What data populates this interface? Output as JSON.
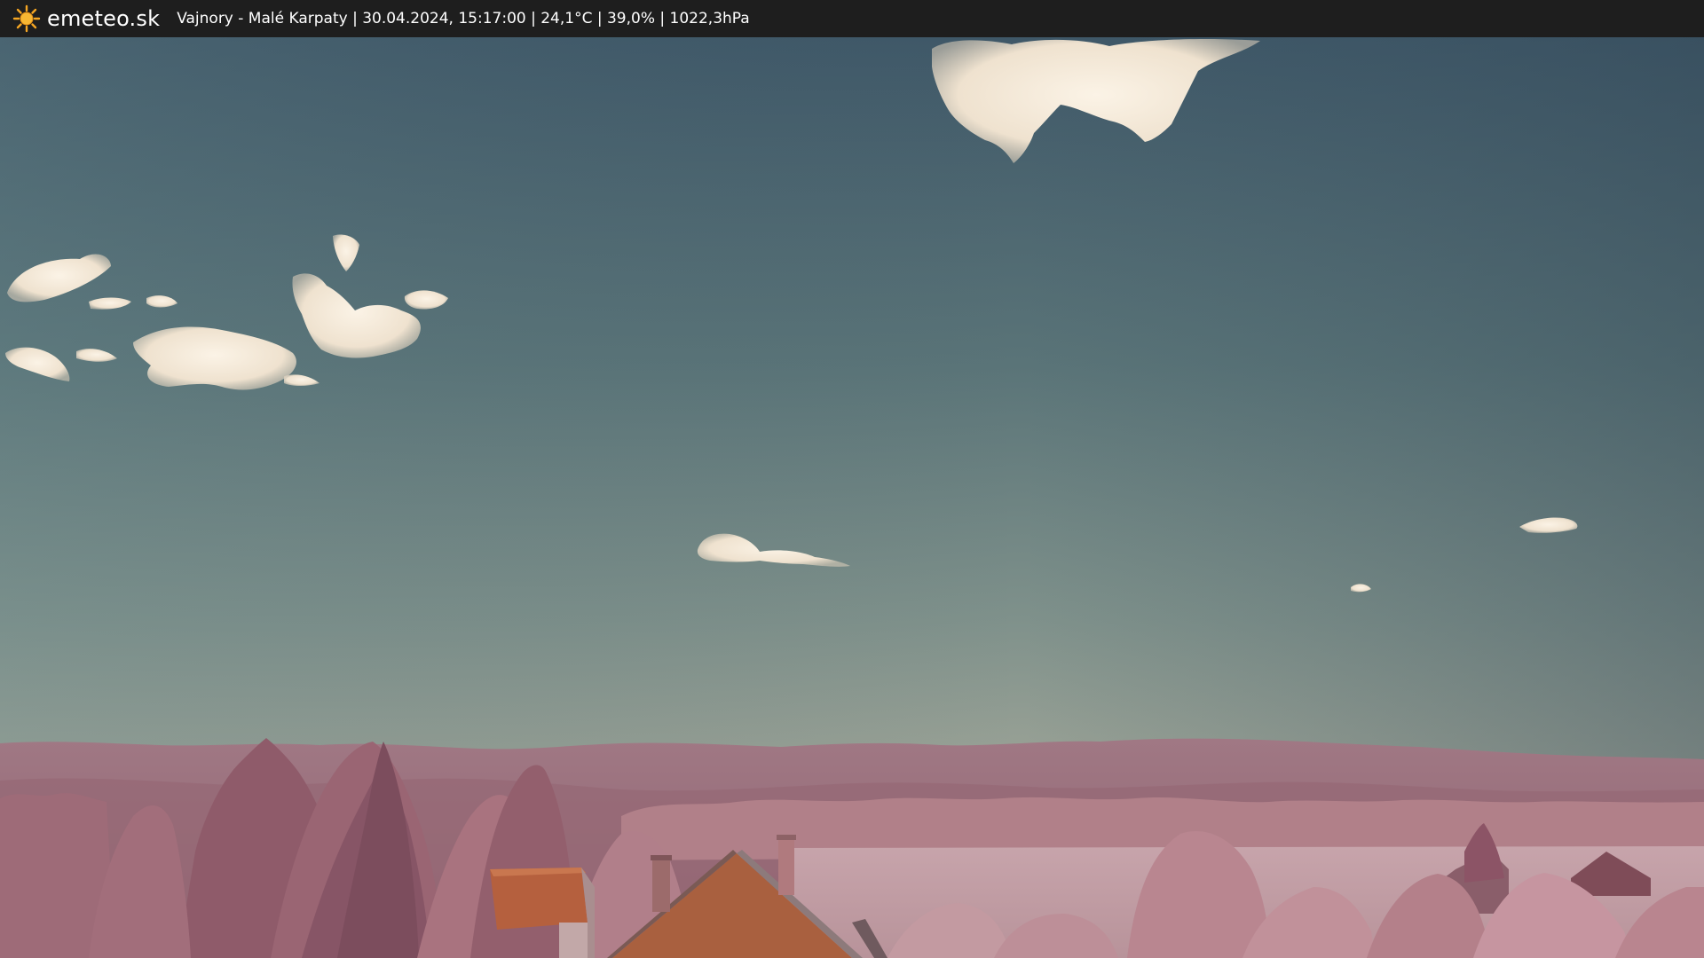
{
  "header": {
    "logo_icon": "sun-icon",
    "brand": "emeteo.sk",
    "caption": "Vajnory - Malé Karpaty | 30.04.2024, 15:17:00 | 24,1°C | 39,0% | 1022,3hPa"
  },
  "colors": {
    "bar": "#1e1e1e",
    "sun": "#f5a623",
    "sky_top": "#3f5a6b",
    "sky_horizon": "#8a9a8f",
    "hills": "#9a6a78",
    "foliage": "#b07a86",
    "roof": "#b5603e"
  }
}
